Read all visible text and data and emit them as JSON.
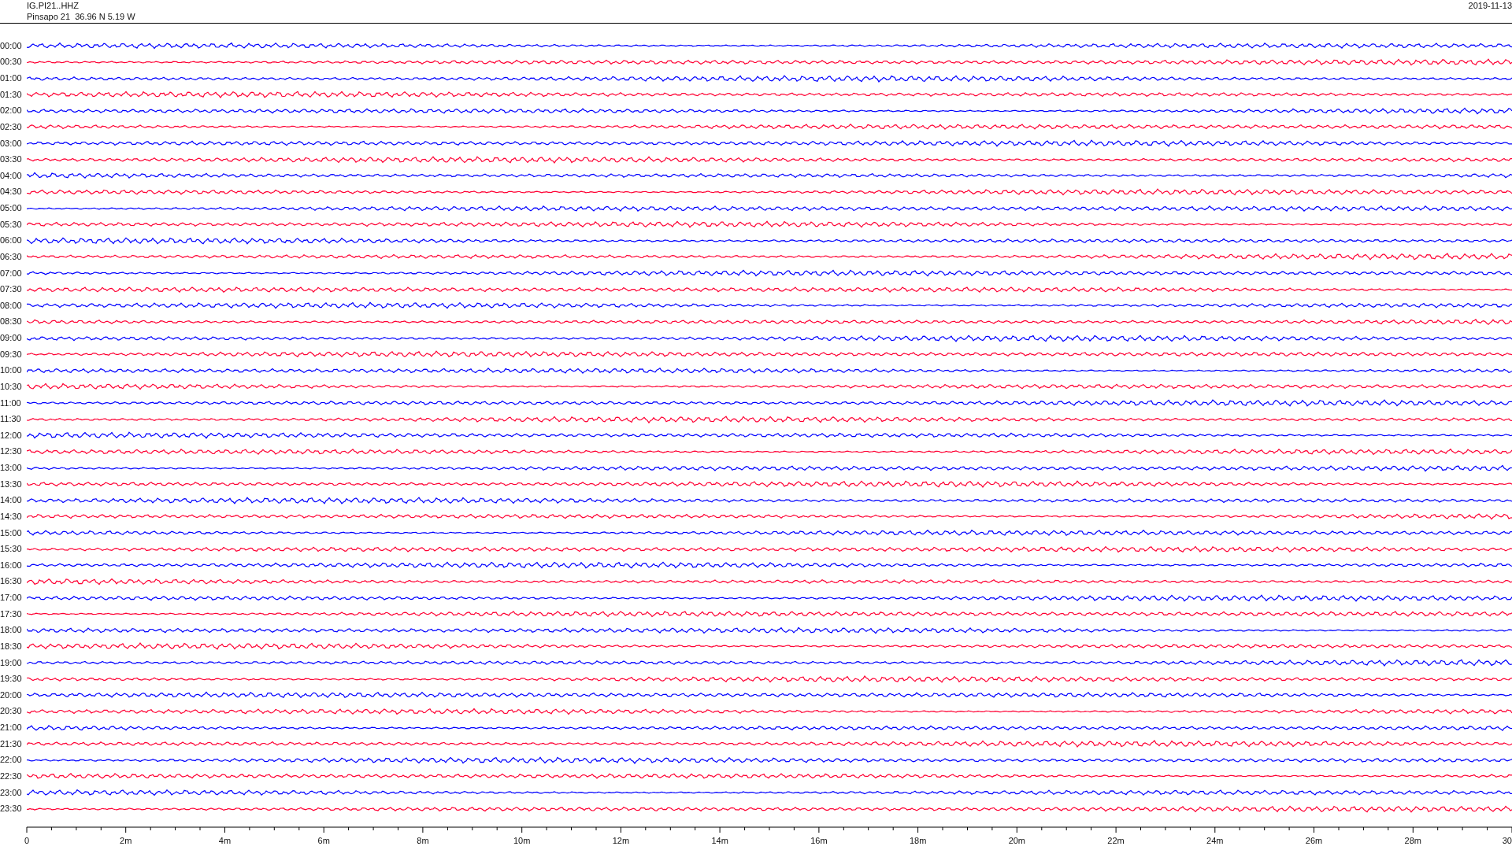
{
  "header": {
    "station": "IG.PI21..HHZ",
    "location": "Pinsapo 21  36.96 N 5.19 W",
    "date": "2019-11-13"
  },
  "rows": [
    {
      "time": "00:00",
      "color": "#0000ff"
    },
    {
      "time": "00:30",
      "color": "#ff0033"
    },
    {
      "time": "01:00",
      "color": "#0000ff"
    },
    {
      "time": "01:30",
      "color": "#ff0033"
    },
    {
      "time": "02:00",
      "color": "#0000ff"
    },
    {
      "time": "02:30",
      "color": "#ff0033"
    },
    {
      "time": "03:00",
      "color": "#0000ff"
    },
    {
      "time": "03:30",
      "color": "#ff0033"
    },
    {
      "time": "04:00",
      "color": "#0000ff"
    },
    {
      "time": "04:30",
      "color": "#ff0033"
    },
    {
      "time": "05:00",
      "color": "#0000ff"
    },
    {
      "time": "05:30",
      "color": "#ff0033"
    },
    {
      "time": "06:00",
      "color": "#0000ff"
    },
    {
      "time": "06:30",
      "color": "#ff0033"
    },
    {
      "time": "07:00",
      "color": "#0000ff"
    },
    {
      "time": "07:30",
      "color": "#ff0033"
    },
    {
      "time": "08:00",
      "color": "#0000ff"
    },
    {
      "time": "08:30",
      "color": "#ff0033"
    },
    {
      "time": "09:00",
      "color": "#0000ff"
    },
    {
      "time": "09:30",
      "color": "#ff0033"
    },
    {
      "time": "10:00",
      "color": "#0000ff"
    },
    {
      "time": "10:30",
      "color": "#ff0033"
    },
    {
      "time": "11:00",
      "color": "#0000ff"
    },
    {
      "time": "11:30",
      "color": "#ff0033"
    },
    {
      "time": "12:00",
      "color": "#0000ff"
    },
    {
      "time": "12:30",
      "color": "#ff0033"
    },
    {
      "time": "13:00",
      "color": "#0000ff"
    },
    {
      "time": "13:30",
      "color": "#ff0033"
    },
    {
      "time": "14:00",
      "color": "#0000ff"
    },
    {
      "time": "14:30",
      "color": "#ff0033"
    },
    {
      "time": "15:00",
      "color": "#0000ff"
    },
    {
      "time": "15:30",
      "color": "#ff0033"
    },
    {
      "time": "16:00",
      "color": "#0000ff"
    },
    {
      "time": "16:30",
      "color": "#ff0033"
    },
    {
      "time": "17:00",
      "color": "#0000ff"
    },
    {
      "time": "17:30",
      "color": "#ff0033"
    },
    {
      "time": "18:00",
      "color": "#0000ff"
    },
    {
      "time": "18:30",
      "color": "#ff0033"
    },
    {
      "time": "19:00",
      "color": "#0000ff"
    },
    {
      "time": "19:30",
      "color": "#ff0033"
    },
    {
      "time": "20:00",
      "color": "#0000ff"
    },
    {
      "time": "20:30",
      "color": "#ff0033"
    },
    {
      "time": "21:00",
      "color": "#0000ff"
    },
    {
      "time": "21:30",
      "color": "#ff0033"
    },
    {
      "time": "22:00",
      "color": "#0000ff"
    },
    {
      "time": "22:30",
      "color": "#ff0033"
    },
    {
      "time": "23:00",
      "color": "#0000ff"
    },
    {
      "time": "23:30",
      "color": "#ff0033"
    }
  ],
  "x_axis": {
    "labels": [
      "0",
      "2m",
      "4m",
      "6m",
      "8m",
      "10m",
      "12m",
      "14m",
      "16m",
      "18m",
      "20m",
      "22m",
      "24m",
      "26m",
      "28m",
      "30"
    ]
  }
}
